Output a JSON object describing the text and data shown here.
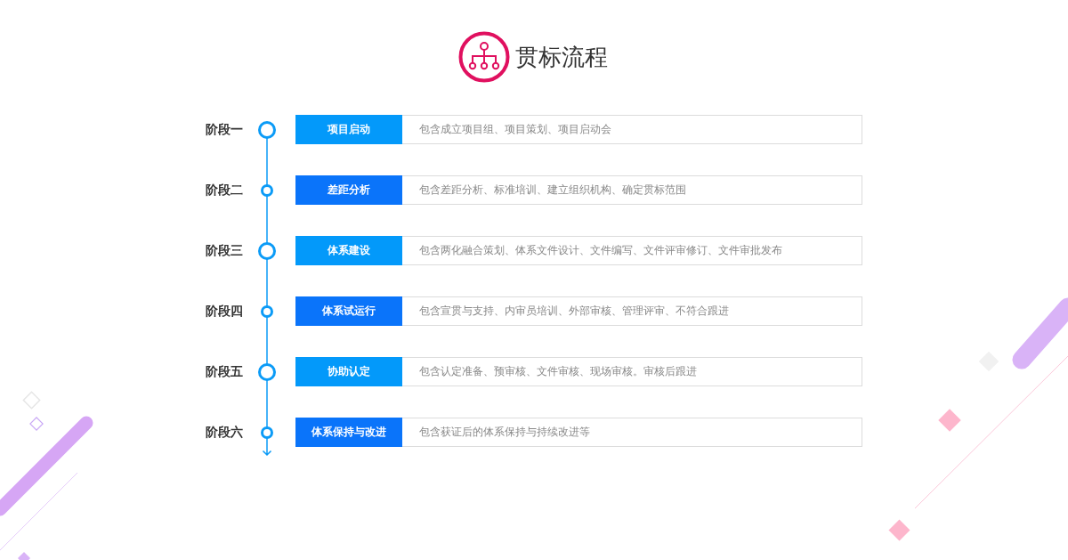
{
  "title": "贯标流程",
  "stages": [
    {
      "label": "阶段一",
      "kind": "major",
      "name": "项目启动",
      "color": "#0399fa",
      "description": "包含成立项目组、项目策划、项目启动会"
    },
    {
      "label": "阶段二",
      "kind": "minor",
      "name": "差距分析",
      "color": "#0a74fa",
      "description": "包含差距分析、标准培训、建立组织机构、确定贯标范围"
    },
    {
      "label": "阶段三",
      "kind": "major",
      "name": "体系建设",
      "color": "#0399fa",
      "description": "包含两化融合策划、体系文件设计、文件编写、文件评审修订、文件审批发布"
    },
    {
      "label": "阶段四",
      "kind": "minor",
      "name": "体系试运行",
      "color": "#0a74fa",
      "description": "包含宣贯与支持、内审员培训、外部审核、管理评审、不符合跟进"
    },
    {
      "label": "阶段五",
      "kind": "major",
      "name": "协助认定",
      "color": "#0399fa",
      "description": "包含认定准备、预审核、文件审核、现场审核。审核后跟进"
    },
    {
      "label": "阶段六",
      "kind": "minor",
      "name": "体系保持与改进",
      "color": "#0a74fa",
      "description": "包含获证后的体系保持与持续改进等"
    }
  ]
}
